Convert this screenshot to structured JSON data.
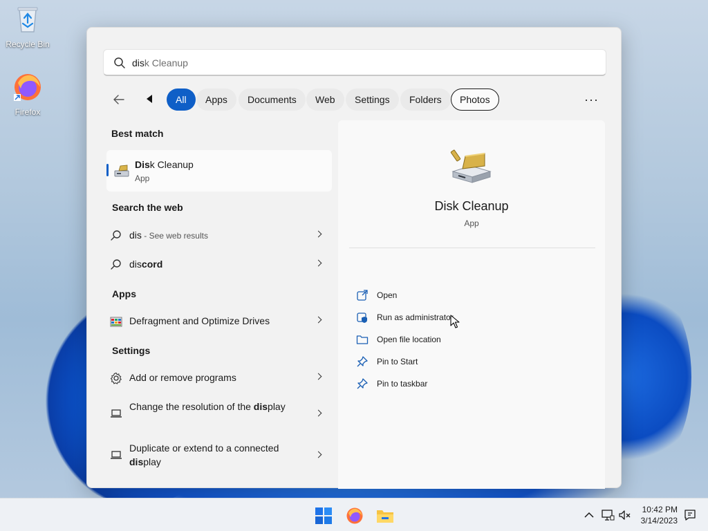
{
  "desktop": {
    "icons": [
      {
        "label": "Recycle Bin",
        "icon": "recycle-bin-icon"
      },
      {
        "label": "Firefox",
        "icon": "firefox-icon"
      }
    ]
  },
  "search": {
    "typed": "dis",
    "suggestion_rest": "k Cleanup"
  },
  "filters": {
    "back_icon": "back-arrow-icon",
    "scroll_left_icon": "scroll-left-icon",
    "chips": [
      "All",
      "Apps",
      "Documents",
      "Web",
      "Settings",
      "Folders",
      "Photos"
    ],
    "active": "All",
    "more": "···"
  },
  "results": {
    "best_match_title": "Best match",
    "best_match": {
      "name_bold": "Dis",
      "name_rest": "k Cleanup",
      "type": "App"
    },
    "web_title": "Search the web",
    "web_items": [
      {
        "main": "dis",
        "sep": " - ",
        "dim": "See web results"
      },
      {
        "bold": "dis",
        "rest": "cord"
      }
    ],
    "apps_title": "Apps",
    "apps_items": [
      {
        "label": "Defragment and Optimize Drives"
      }
    ],
    "settings_title": "Settings",
    "settings_items": [
      {
        "label": "Add or remove programs"
      },
      {
        "pre": "Change the resolution of the ",
        "bold": "dis",
        "post": "play"
      },
      {
        "pre": "Duplicate or extend to a connected ",
        "bold": "dis",
        "post": "play"
      }
    ]
  },
  "preview": {
    "title": "Disk Cleanup",
    "type": "App",
    "actions": [
      {
        "label": "Open",
        "icon": "open-external-icon"
      },
      {
        "label": "Run as administrator",
        "icon": "shield-admin-icon"
      },
      {
        "label": "Open file location",
        "icon": "folder-icon"
      },
      {
        "label": "Pin to Start",
        "icon": "pin-icon"
      },
      {
        "label": "Pin to taskbar",
        "icon": "pin-icon"
      }
    ]
  },
  "taskbar": {
    "apps": [
      "windows-start-icon",
      "firefox-icon",
      "file-explorer-icon"
    ],
    "tray": [
      "chevron-up-icon",
      "network-icon",
      "volume-mute-icon",
      "notification-icon"
    ],
    "time": "10:42 PM",
    "date": "3/14/2023"
  },
  "colors": {
    "accent": "#0f5fc7"
  }
}
